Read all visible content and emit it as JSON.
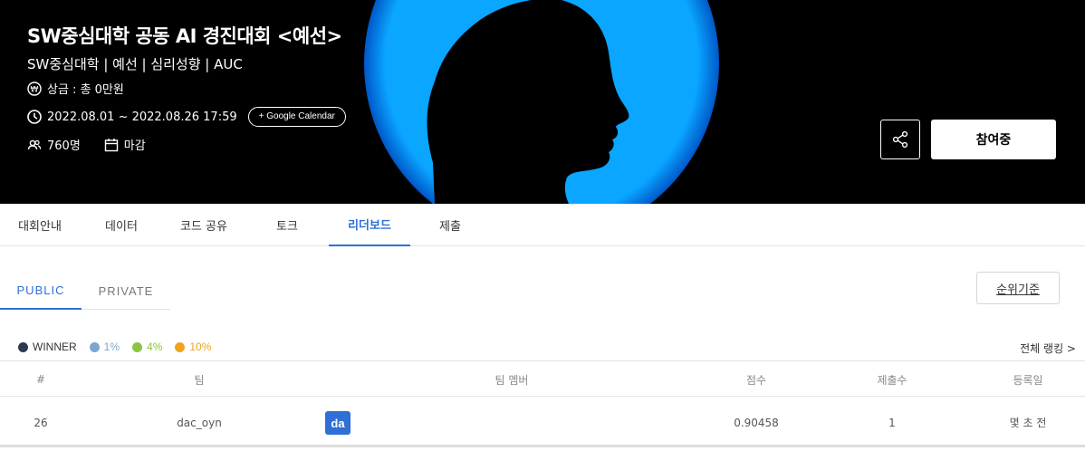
{
  "hero": {
    "title": "SW중심대학 공동 AI 경진대회 <예선>",
    "subtitle": "SW중심대학 | 예선 | 심리성향 | AUC",
    "prize": "상금 : 총 0만원",
    "period": "2022.08.01 ~ 2022.08.26 17:59",
    "gcal_label": "+ Google Calendar",
    "participants": "760명",
    "status": "마감",
    "join_label": "참여중",
    "colors": {
      "accent": "#0aa6ff",
      "background": "#000000"
    }
  },
  "tabs": [
    {
      "label": "대회안내"
    },
    {
      "label": "데이터"
    },
    {
      "label": "코드 공유"
    },
    {
      "label": "토크"
    },
    {
      "label": "리더보드",
      "active": true
    },
    {
      "label": "제출"
    }
  ],
  "leaderboard": {
    "subtabs": [
      {
        "label": "PUBLIC",
        "active": true
      },
      {
        "label": "PRIVATE"
      }
    ],
    "rank_criteria_label": "순위기준",
    "legend": [
      {
        "label": "WINNER",
        "color": "#2b3a4e"
      },
      {
        "label": "1%",
        "color": "#7ba7cf"
      },
      {
        "label": "4%",
        "color": "#8ac53e"
      },
      {
        "label": "10%",
        "color": "#f0a21e"
      }
    ],
    "all_ranking_label": "전체 랭킹 >",
    "columns": [
      "#",
      "팀",
      "팀 멤버",
      "점수",
      "제출수",
      "등록일"
    ],
    "rows": [
      {
        "rank": "26",
        "team": "dac_oyn",
        "member_badge": "da",
        "score": "0.90458",
        "submissions": "1",
        "date": "몇 초 전"
      }
    ]
  }
}
